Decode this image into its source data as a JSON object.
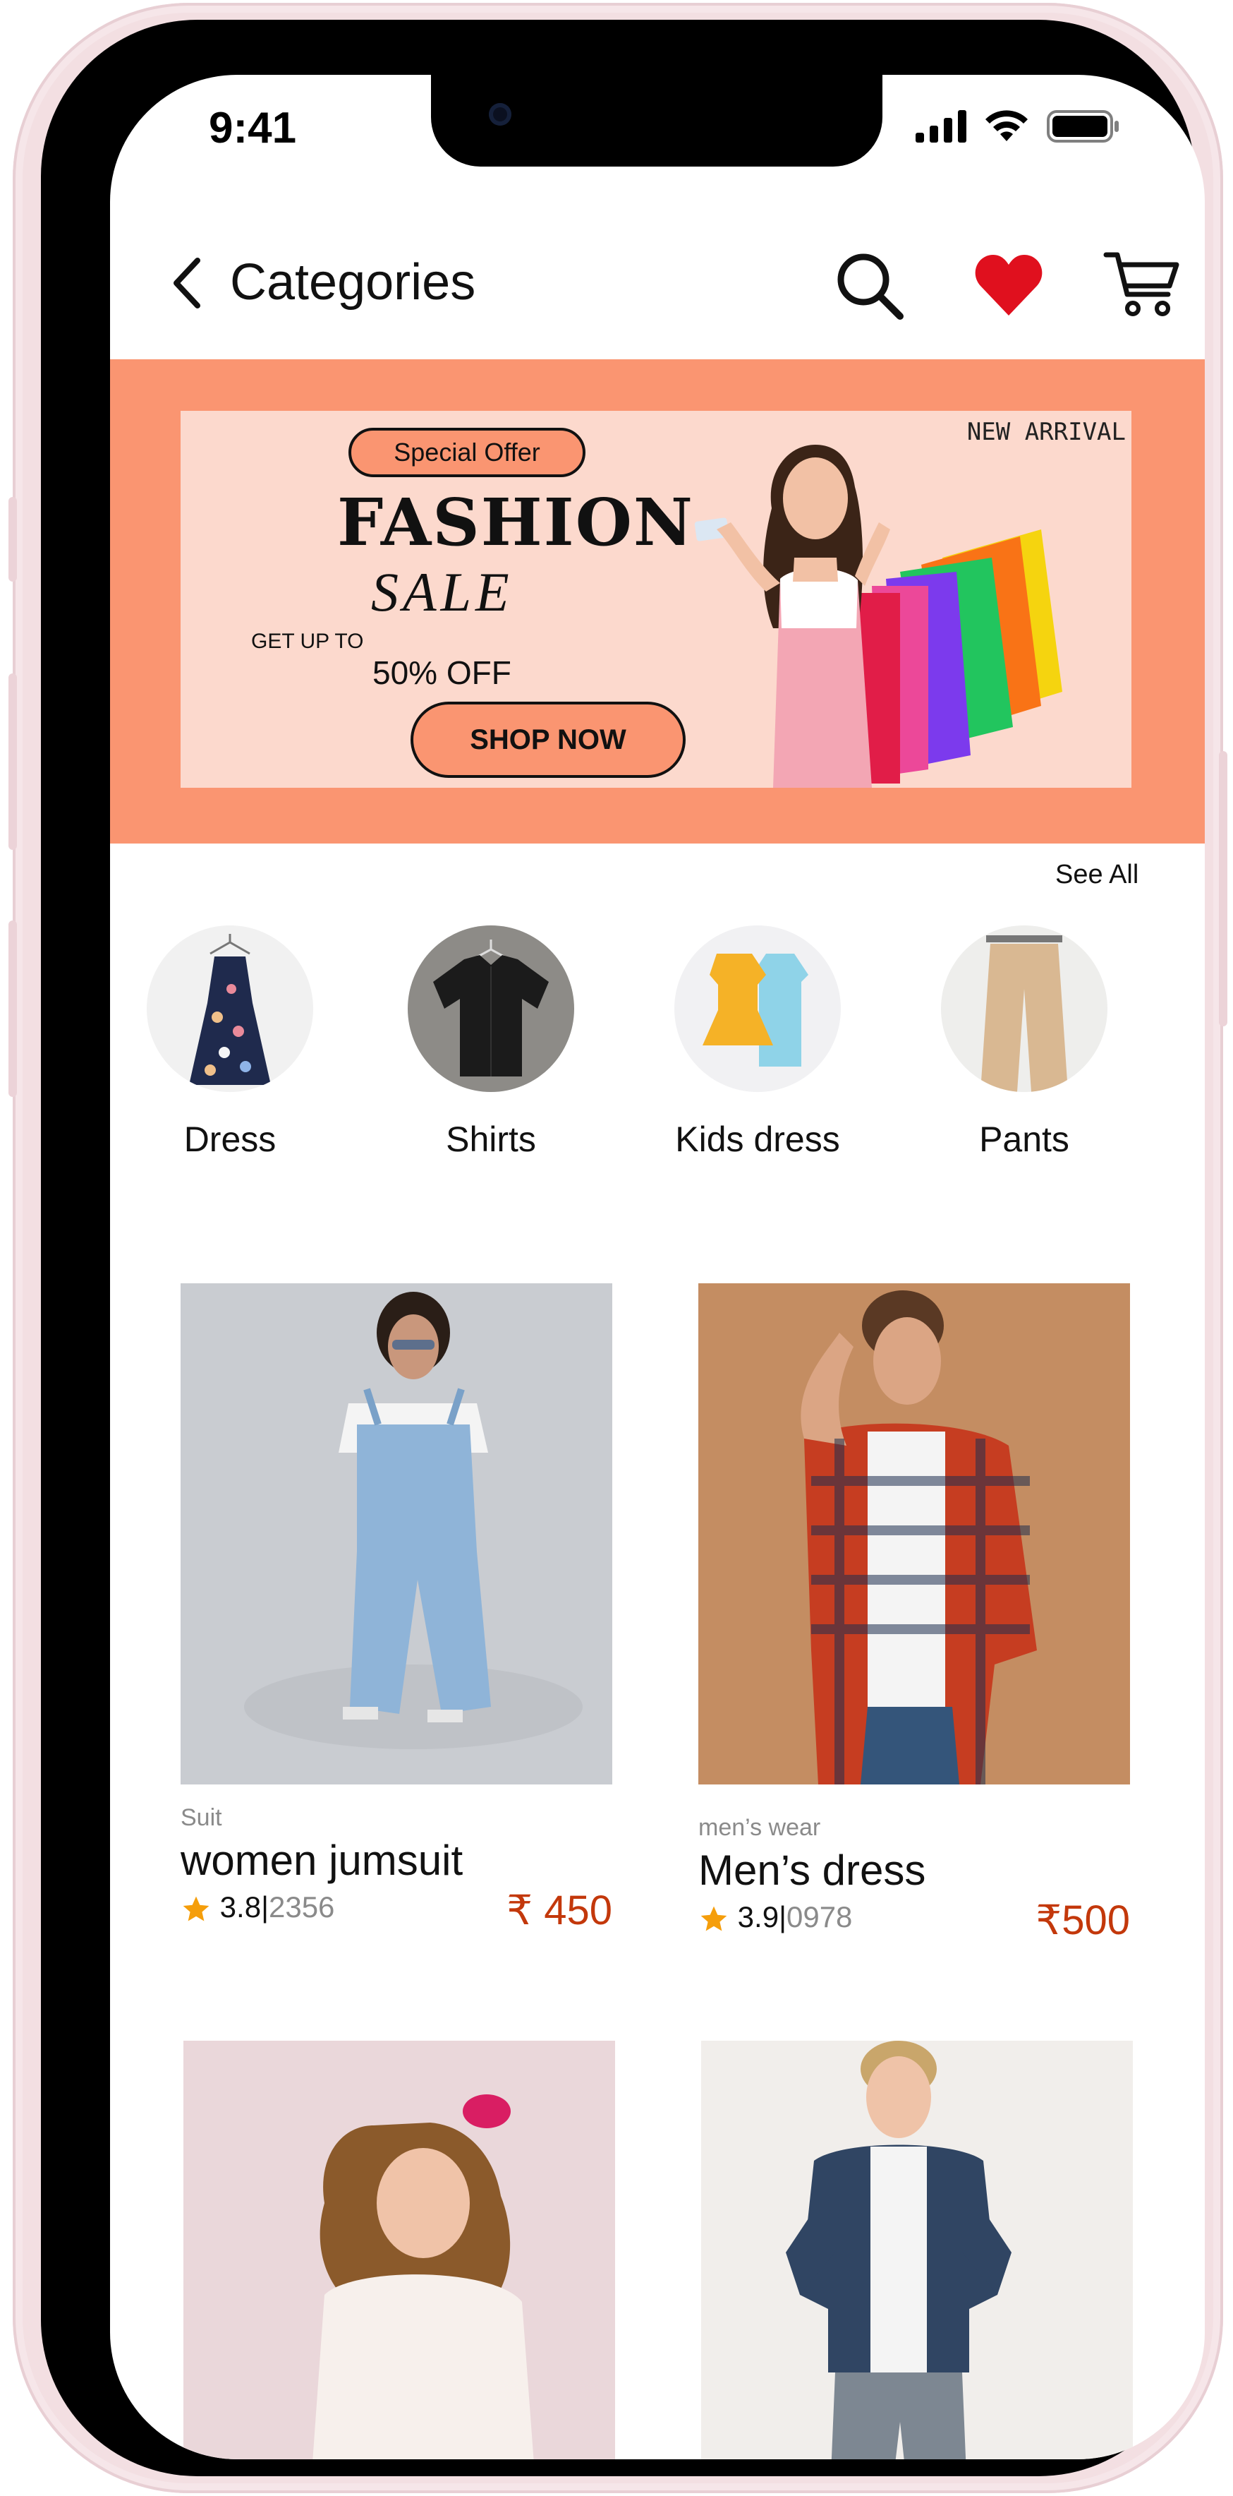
{
  "status": {
    "time": "9:41"
  },
  "nav": {
    "title": "Categories"
  },
  "banner": {
    "badge": "Special Offer",
    "headline": "FASHION",
    "subheadline": "SALE",
    "get_up_to": "GET UP TO",
    "discount": "50% OFF",
    "cta": "SHOP NOW",
    "tag": "NEW ARRIVAL",
    "background": "#fa9571",
    "inner_background": "#fcd9cd"
  },
  "categories": {
    "see_all": "See All",
    "items": [
      {
        "label": "Dress"
      },
      {
        "label": "Shirts"
      },
      {
        "label": "Kids dress"
      },
      {
        "label": "Pants"
      }
    ]
  },
  "products": [
    {
      "category": "Suit",
      "title": "women  jumsuit",
      "rating": "3.8",
      "separator": "|",
      "reviews": "2356",
      "price": "₹ 450"
    },
    {
      "category": "men’s wear",
      "title": "Men’s dress",
      "rating": "3.9",
      "separator": "|",
      "reviews": "0978",
      "price": "₹500"
    },
    {
      "category": "",
      "title": "",
      "rating": "",
      "separator": "",
      "reviews": "",
      "price": ""
    },
    {
      "category": "",
      "title": "",
      "rating": "",
      "separator": "",
      "reviews": "",
      "price": ""
    }
  ],
  "colors": {
    "accent": "#c3380b",
    "heart": "#e0101e",
    "star": "#f59e0b"
  }
}
